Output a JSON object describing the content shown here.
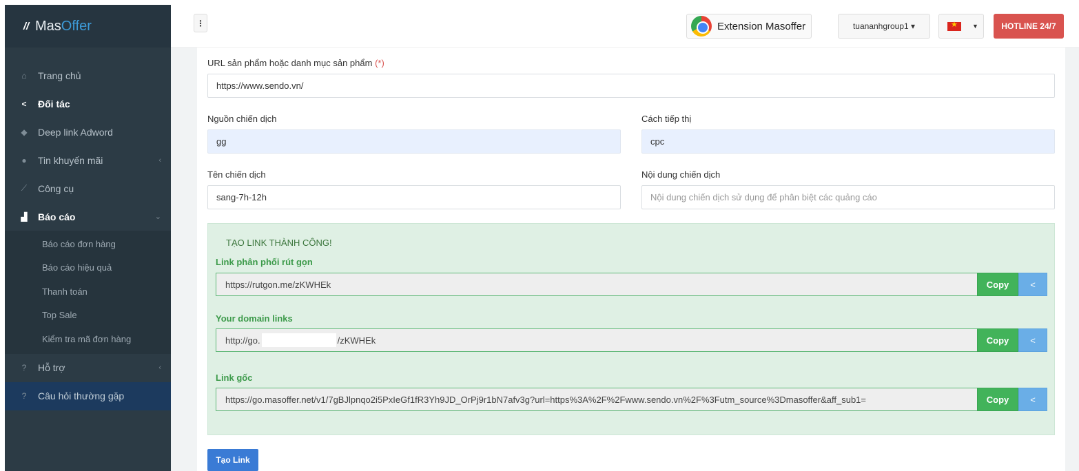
{
  "brand": {
    "name_part1": "Mas",
    "name_part2": "Offer"
  },
  "sidebar": {
    "items": [
      {
        "label": "Trang chủ",
        "icon": "home-icon"
      },
      {
        "label": "Đối tác",
        "icon": "share-icon"
      },
      {
        "label": "Deep link Adword",
        "icon": "diamond-icon"
      },
      {
        "label": "Tin khuyến mãi",
        "icon": "tag-icon"
      },
      {
        "label": "Công cụ",
        "icon": "wand-icon"
      },
      {
        "label": "Báo cáo",
        "icon": "chart-icon"
      }
    ],
    "submenu": [
      {
        "label": "Báo cáo đơn hàng"
      },
      {
        "label": "Báo cáo hiệu quả"
      },
      {
        "label": "Thanh toán"
      },
      {
        "label": "Top Sale"
      },
      {
        "label": "Kiểm tra mã đơn hàng"
      }
    ],
    "support": {
      "label": "Hỗ trợ",
      "icon": "help-circle-icon"
    },
    "faq": {
      "label": "Câu hỏi thường gặp",
      "icon": "help-circle-icon"
    }
  },
  "topbar": {
    "extension_label": "Extension Masoffer",
    "user_label": "tuananhgroup1 ▾",
    "hotline_label": "HOTLINE 24/7"
  },
  "form": {
    "url_label": "URL sản phẩm hoặc danh mục sản phẩm",
    "url_required": "(*)",
    "url_value": "https://www.sendo.vn/",
    "source_label": "Nguồn chiến dịch",
    "source_value": "gg",
    "medium_label": "Cách tiếp thị",
    "medium_value": "cpc",
    "name_label": "Tên chiến dịch",
    "name_value": "sang-7h-12h",
    "content_label": "Nội dung chiến dịch",
    "content_placeholder": "Nội dung chiến dịch sử dụng để phân biệt các quảng cáo",
    "submit_label": "Tạo Link"
  },
  "result": {
    "title": "TẠO LINK THÀNH CÔNG!",
    "short_label": "Link phân phối rút gọn",
    "short_value": "https://rutgon.me/zKWHEk",
    "domain_label": "Your domain links",
    "domain_value_prefix": "http://go.",
    "domain_value_suffix": "/zKWHEk",
    "original_label": "Link gốc",
    "original_value": "https://go.masoffer.net/v1/7gBJlpnqo2i5PxIeGf1fR3Yh9JD_OrPj9r1bN7afv3g?url=https%3A%2F%2Fwww.sendo.vn%2F%3Futm_source%3Dmasoffer&aff_sub1=",
    "copy_label": "Copy"
  }
}
